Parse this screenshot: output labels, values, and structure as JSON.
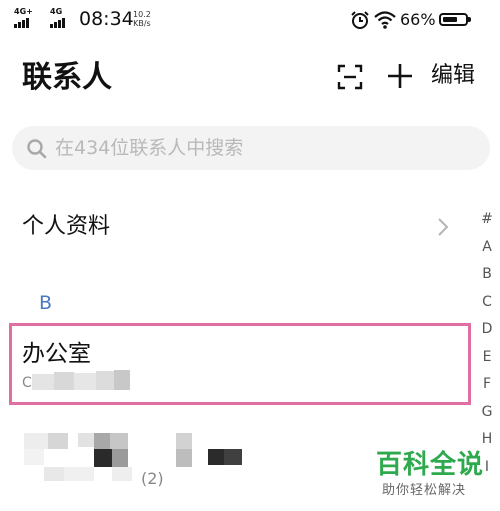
{
  "status_bar": {
    "network_1": "4G+",
    "network_2": "4G",
    "time": "08:34",
    "speed_value": "10.2",
    "speed_unit": "KB/s",
    "alarm_icon": "alarm-icon",
    "wifi_icon": "wifi-icon",
    "battery_percent": "66%",
    "battery_level": 0.66
  },
  "header": {
    "title": "联系人",
    "scan_icon": "scan-icon",
    "add_icon": "add-icon",
    "edit_label": "编辑"
  },
  "search": {
    "placeholder": "在434位联系人中搜索"
  },
  "profile": {
    "label": "个人资料"
  },
  "section_letter": "B",
  "contacts": [
    {
      "name": "办公室",
      "number": "C"
    },
    {
      "name": "",
      "number": "(2)"
    }
  ],
  "index_letters": [
    "#",
    "A",
    "B",
    "C",
    "D",
    "E",
    "F",
    "G",
    "H",
    "I"
  ],
  "watermark": {
    "title": "百科全说",
    "subtitle": "助你轻松解决"
  },
  "colors": {
    "section_letter": "#4a78c2",
    "highlight_border": "#de6fa0",
    "watermark": "#2ea94d"
  }
}
